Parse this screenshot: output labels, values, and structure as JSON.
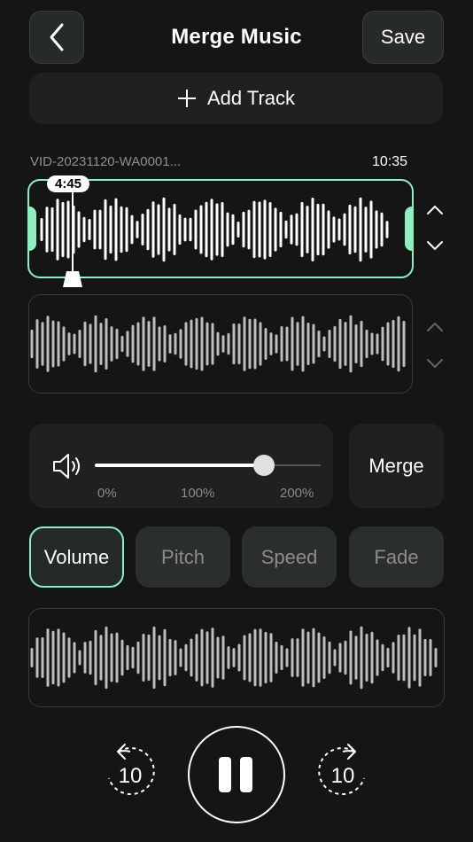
{
  "header": {
    "title": "Merge Music",
    "save_label": "Save"
  },
  "add_track": {
    "label": "Add Track"
  },
  "track1": {
    "filename": "VID-20231120-WA0001...",
    "duration": "10:35",
    "playhead_time": "4:45"
  },
  "volume": {
    "labels": [
      "0%",
      "100%",
      "200%"
    ],
    "level_percent": 150
  },
  "merge_label": "Merge",
  "tabs": [
    {
      "label": "Volume",
      "active": true
    },
    {
      "label": "Pitch",
      "active": false
    },
    {
      "label": "Speed",
      "active": false
    },
    {
      "label": "Fade",
      "active": false
    }
  ],
  "playback": {
    "rewind_label": "10",
    "forward_label": "10"
  },
  "colors": {
    "accent": "#8ef0c2",
    "background": "#151515"
  }
}
